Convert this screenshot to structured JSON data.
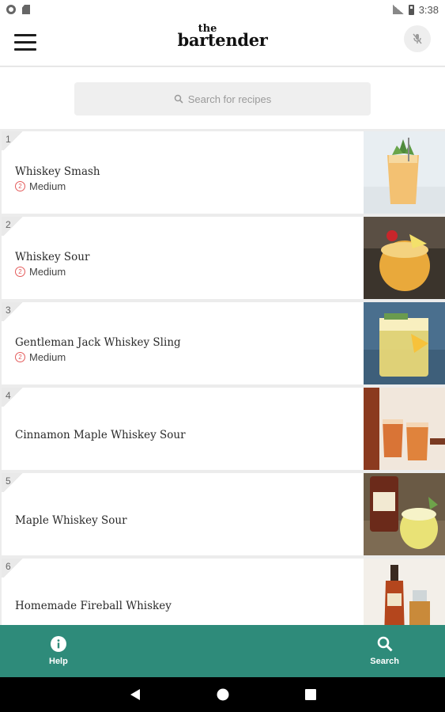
{
  "status_bar": {
    "time": "3:38",
    "network": "LTE"
  },
  "app_bar": {
    "logo_small": "the",
    "logo_main": "bartender",
    "menu_icon": "hamburger-menu-icon",
    "mic_icon": "microphone-off-icon"
  },
  "search": {
    "placeholder": "Search for recipes",
    "icon": "search-icon"
  },
  "recipes": [
    {
      "index": "1",
      "title": "Whiskey Smash",
      "difficulty": "Medium",
      "difficulty_glyph": "2"
    },
    {
      "index": "2",
      "title": "Whiskey Sour",
      "difficulty": "Medium",
      "difficulty_glyph": "2"
    },
    {
      "index": "3",
      "title": "Gentleman Jack Whiskey Sling",
      "difficulty": "Medium",
      "difficulty_glyph": "2"
    },
    {
      "index": "4",
      "title": "Cinnamon Maple Whiskey Sour"
    },
    {
      "index": "5",
      "title": "Maple Whiskey Sour"
    },
    {
      "index": "6",
      "title": "Homemade Fireball Whiskey"
    }
  ],
  "bottom_nav": {
    "help_label": "Help",
    "help_icon": "info-icon",
    "search_label": "Search",
    "search_icon": "search-icon"
  },
  "system_nav": [
    "back-icon",
    "home-icon",
    "recents-icon"
  ],
  "colors": {
    "accent": "#2e8b7a",
    "difficulty": "#e35b5b"
  }
}
